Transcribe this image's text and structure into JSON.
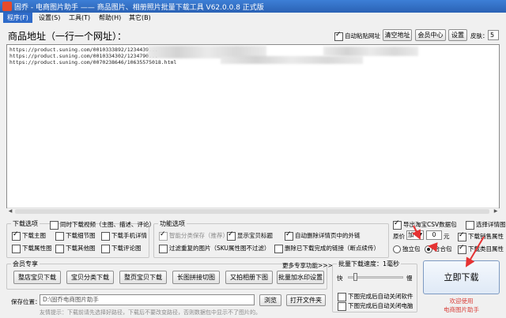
{
  "window": {
    "title": "固乔 - 电商图片助手 —— 商品图片、相册照片批量下载工具 V62.0.0.8 正式版"
  },
  "menu": [
    "程序(F)",
    "设置(S)",
    "工具(T)",
    "帮助(H)",
    "其它(B)"
  ],
  "url_area": {
    "label": "商品地址（一行一个网址）：",
    "auto_paste_label": "自动粘贴网址",
    "clear_button": "清空地址",
    "member_button": "会员中心",
    "settings_button": "设置",
    "skin_label": "皮肤：",
    "skin_value": "5",
    "urls": [
      "https://product.suning.com/0010333892/1234439...",
      "https://product.suning.com/0010334302/1234790...",
      "https://product.suning.com/0070238646/10635575018.html"
    ]
  },
  "download_options": {
    "title": "下载选项",
    "sync_video_label": "同时下载视频（主图、描述、评论）",
    "items": [
      "下载主图",
      "下载细节图",
      "下载手机详情",
      "下载属性图",
      "下载其他图",
      "下载评论图"
    ]
  },
  "function_options": {
    "title": "功能选项",
    "smart_save_label": "智能分类保存（推荐）",
    "show_title_label": "显示宝贝标题",
    "auto_delete_label": "自动删除详情页中的外链",
    "filter_label": "过滤重复的图片（SKU属性图不过滤）",
    "delete_done_label": "删除已下载完成的链接（断点续传）"
  },
  "right_options": {
    "export_csv_label": "导出淘宝CSV数据包",
    "select_detail_label": "选择详情图",
    "original_price_label": "原价",
    "price_op": "加",
    "price_value": "0",
    "price_unit": "元",
    "sales_attr_label": "下载销售属性",
    "standalone_label": "独立包",
    "combined_label": "合合包",
    "category_attr_label": "下载类目属性"
  },
  "member_exclusive": {
    "title": "会员专享",
    "more_label": "更多专享功能>>>",
    "buttons": [
      "整店宝贝下载",
      "宝贝分类下载",
      "整页宝贝下载",
      "长图拼接切图",
      "又拍相册下图",
      "批量加水印设置"
    ]
  },
  "batch_speed": {
    "title": "批量下载速度：1毫秒",
    "fast_label": "快",
    "slow_label": "慢",
    "speed_percent": 10,
    "auto_close_label": "下图完成后自动关闭软件",
    "auto_shutdown_label": "下图完成后自动关闭电脑"
  },
  "save": {
    "label": "保存位置：",
    "path": "D:\\固乔电商图片助手",
    "browse_button": "浏览",
    "open_button": "打开文件夹",
    "hint": "友情提示：下载前请先选择好路径，下载后不要改变路径，否则数据包中显示不了图片的。"
  },
  "action": {
    "download_button": "立即下载",
    "welcome_line1": "欢迎使用",
    "welcome_line2": "电商图片助手"
  },
  "colors": {
    "title_bar": "#2b62b5",
    "menu_active": "#2e6ac9",
    "accent_red": "#d9413b"
  }
}
